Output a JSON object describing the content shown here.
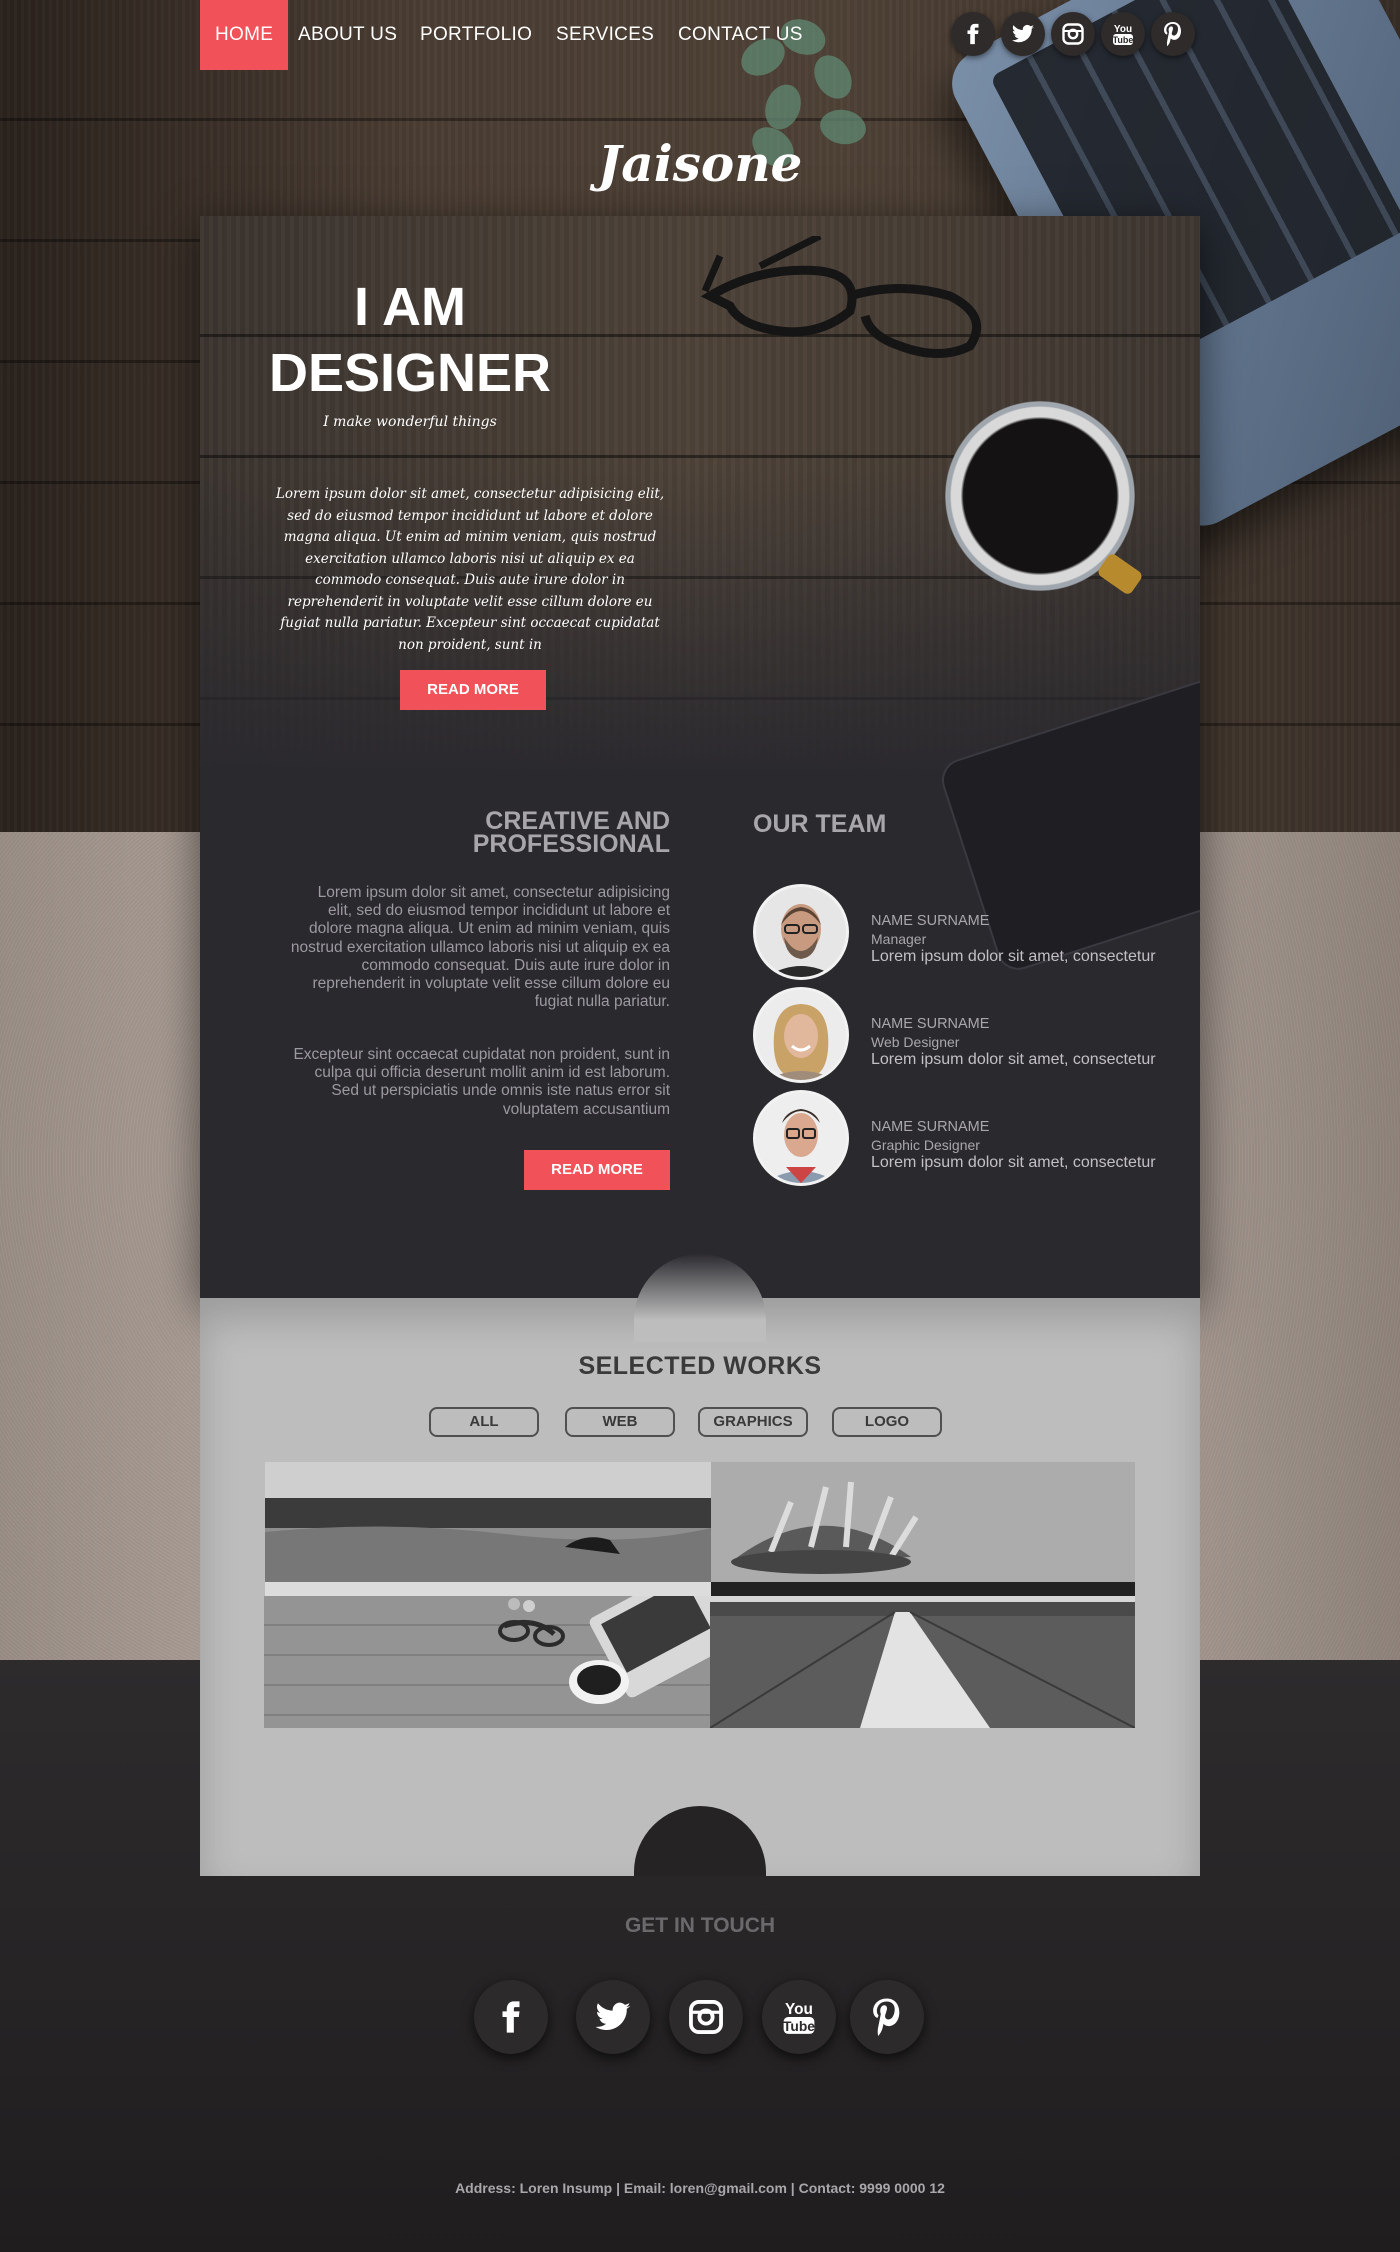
{
  "nav": {
    "items": [
      {
        "label": "HOME",
        "active": true
      },
      {
        "label": "ABOUT US",
        "active": false
      },
      {
        "label": "PORTFOLIO",
        "active": false
      },
      {
        "label": "SERVICES",
        "active": false
      },
      {
        "label": "CONTACT US",
        "active": false
      }
    ],
    "social": [
      "facebook-icon",
      "twitter-icon",
      "instagram-icon",
      "youtube-icon",
      "pinterest-icon"
    ]
  },
  "brand": "Jaisone",
  "hero": {
    "title_line1": "I AM",
    "title_line2": "DESIGNER",
    "tagline": "I make wonderful things",
    "text": "Lorem ipsum dolor sit amet, consectetur adipisicing elit, sed do eiusmod tempor incididunt ut labore et dolore magna aliqua. Ut enim ad minim veniam, quis nostrud exercitation ullamco laboris nisi ut aliquip ex ea commodo consequat. Duis aute irure dolor in reprehenderit in voluptate velit esse cillum dolore eu fugiat nulla pariatur. Excepteur sint occaecat cupidatat non proident, sunt in",
    "button": "READ MORE"
  },
  "creative": {
    "title_line1": "CREATIVE AND",
    "title_line2": "PROFESSIONAL",
    "para1": "Lorem ipsum dolor sit amet, consectetur adipisicing elit, sed do eiusmod tempor incididunt ut labore et dolore magna aliqua. Ut enim ad minim veniam, quis nostrud exercitation ullamco laboris nisi ut aliquip ex ea commodo consequat. Duis aute irure dolor in reprehenderit in voluptate velit esse cillum dolore eu fugiat nulla pariatur.",
    "para2": "Excepteur sint occaecat cupidatat non proident, sunt in culpa qui officia deserunt mollit anim id est laborum. Sed ut perspiciatis unde omnis iste natus error sit voluptatem accusantium",
    "button": "READ MORE"
  },
  "team": {
    "title": "OUR TEAM",
    "members": [
      {
        "name": "NAME SURNAME",
        "role": "Manager",
        "text": "Lorem ipsum dolor sit amet, consectetur"
      },
      {
        "name": "NAME SURNAME",
        "role": "Web Designer",
        "text": "Lorem ipsum dolor sit amet, consectetur"
      },
      {
        "name": "NAME SURNAME",
        "role": "Graphic Designer",
        "text": "Lorem ipsum dolor sit amet, consectetur"
      }
    ]
  },
  "works": {
    "title": "SELECTED WORKS",
    "filters": [
      "ALL",
      "WEB",
      "GRAPHICS",
      "LOGO"
    ]
  },
  "footer": {
    "title": "GET IN TOUCH",
    "social": [
      "facebook-icon",
      "twitter-icon",
      "instagram-icon",
      "youtube-icon",
      "pinterest-icon"
    ],
    "info": "Address: Loren Insump | Email: loren@gmail.com | Contact: 9999 0000 12"
  },
  "colors": {
    "accent": "#f15158",
    "card": "#2a292e",
    "works_panel": "#bdbdbd"
  }
}
